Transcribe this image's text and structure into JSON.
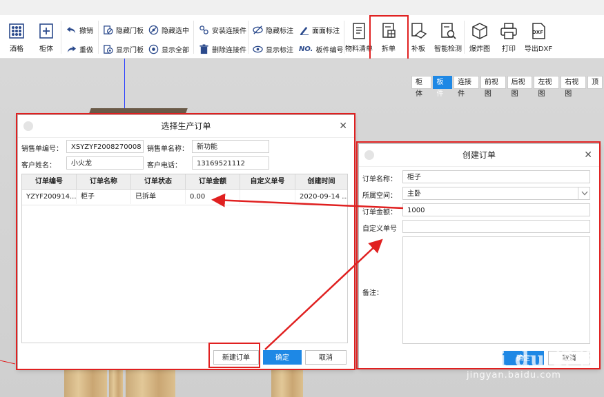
{
  "toolbar": {
    "big_left": [
      {
        "label": "酒格",
        "icon": "wine-rack-icon"
      },
      {
        "label": "柜体",
        "icon": "cabinet-add-icon"
      }
    ],
    "small": [
      {
        "label": "撤销",
        "icon": "undo-icon"
      },
      {
        "label": "重做",
        "icon": "redo-icon"
      },
      {
        "label": "隐藏门板",
        "icon": "hide-door-icon"
      },
      {
        "label": "显示门板",
        "icon": "show-door-icon"
      },
      {
        "label": "隐藏选中",
        "icon": "hide-selected-icon"
      },
      {
        "label": "显示全部",
        "icon": "show-all-icon"
      },
      {
        "label": "安装连接件",
        "icon": "install-connector-icon"
      },
      {
        "label": "删除连接件",
        "icon": "delete-connector-icon"
      },
      {
        "label": "隐藏标注",
        "icon": "hide-annotation-icon"
      },
      {
        "label": "显示标注",
        "icon": "show-annotation-icon"
      },
      {
        "label": "面面标注",
        "icon": "face-annotation-icon"
      },
      {
        "label": "板件编号",
        "icon": "panel-number-icon"
      }
    ],
    "big_right": [
      {
        "label": "物料清单",
        "icon": "material-list-icon"
      },
      {
        "label": "拆单",
        "icon": "split-order-icon"
      },
      {
        "label": "补板",
        "icon": "patch-panel-icon"
      },
      {
        "label": "智能检测",
        "icon": "smart-detect-icon"
      },
      {
        "label": "爆炸图",
        "icon": "exploded-view-icon"
      },
      {
        "label": "打印",
        "icon": "print-icon"
      },
      {
        "label": "导出DXF",
        "icon": "export-dxf-icon"
      }
    ],
    "no_badge": "NO."
  },
  "view_tabs": [
    "柜体",
    "板件",
    "连接件",
    "前视图",
    "后视图",
    "左视图",
    "右视图",
    "顶"
  ],
  "view_tab_active": "板件",
  "select_dialog": {
    "title": "选择生产订单",
    "sales_no_label": "销售单编号：",
    "sales_no_value": "XSYZYF2008270008",
    "sales_name_label": "销售单名称：",
    "sales_name_value": "新功能",
    "customer_label": "客户姓名：",
    "customer_value": "小火龙",
    "phone_label": "客户电话：",
    "phone_value": "13169521112",
    "columns": [
      "订单编号",
      "订单名称",
      "订单状态",
      "订单金额",
      "自定义单号",
      "创建时间"
    ],
    "rows": [
      [
        "YZYF200914...",
        "柜子",
        "已拆单",
        "0.00",
        "",
        "2020-09-14 ..."
      ]
    ],
    "new_order_btn": "新建订单",
    "confirm_btn": "确定",
    "cancel_btn": "取消"
  },
  "create_dialog": {
    "title": "创建订单",
    "name_label": "订单名称：",
    "name_value": "柜子",
    "space_label": "所属空间：",
    "space_value": "主卧",
    "amount_label": "订单金额：",
    "amount_value": "1000",
    "custom_no_label": "自定义单号",
    "custom_no_value": "",
    "remark_label": "备注：",
    "remark_value": "",
    "confirm_btn": "确定",
    "cancel_btn": "取消"
  },
  "watermark": {
    "brand": "Bai du 经验",
    "url": "jingyan.baidu.com"
  },
  "colors": {
    "accent": "#1e88e5",
    "highlight": "#e02020",
    "icon": "#2b4a8c"
  }
}
